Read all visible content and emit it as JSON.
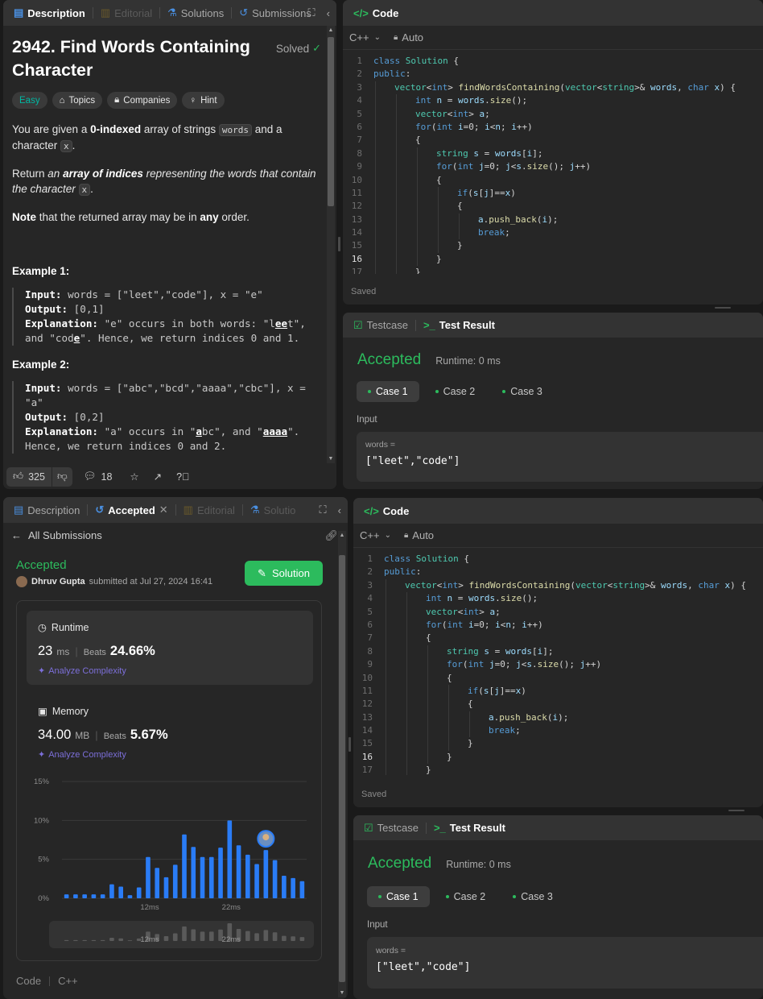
{
  "top_left": {
    "tabs": [
      "Description",
      "Editorial",
      "Solutions",
      "Submissions"
    ],
    "title": "2942. Find Words Containing Character",
    "solved": "Solved",
    "chips": [
      "Easy",
      "Topics",
      "Companies",
      "Hint"
    ],
    "p1_a": "You are given a ",
    "p1_b": "0-indexed",
    "p1_c": " array of strings ",
    "p1_code1": "words",
    "p1_d": " and a character ",
    "p1_code2": "x",
    "p1_e": ".",
    "p2_a": "Return ",
    "p2_b": "an ",
    "p2_c": "array of indices",
    "p2_d": " representing the words that contain the character ",
    "p2_code": "x",
    "p2_e": ".",
    "p3_a": "Note",
    "p3_b": " that the returned array may be in ",
    "p3_c": "any",
    "p3_d": " order.",
    "ex1_title": "Example 1:",
    "ex1_input_label": "Input:",
    "ex1_input": " words = [\"leet\",\"code\"], x = \"e\"",
    "ex1_output_label": "Output:",
    "ex1_output": " [0,1]",
    "ex1_expl_label": "Explanation:",
    "ex1_expl_a": " \"e\" occurs in both words: \"l",
    "ex1_expl_b": "ee",
    "ex1_expl_c": "t\",",
    "ex1_expl_d": "and \"cod",
    "ex1_expl_e": "e",
    "ex1_expl_f": "\". Hence, we return indices 0 and 1.",
    "ex2_title": "Example 2:",
    "ex2_input_label": "Input:",
    "ex2_input": " words = [\"abc\",\"bcd\",\"aaaa\",\"cbc\"], x =",
    "ex2_input2": "\"a\"",
    "ex2_output_label": "Output:",
    "ex2_output": " [0,2]",
    "ex2_expl_label": "Explanation:",
    "ex2_expl_a": " \"a\" occurs in \"",
    "ex2_expl_b": "a",
    "ex2_expl_c": "bc\", and \"",
    "ex2_expl_d": "aaaa",
    "ex2_expl_e": "\".",
    "ex2_expl_f": "Hence, we return indices 0 and 2.",
    "likes": "325",
    "comments": "18"
  },
  "code": {
    "tab_label": "Code",
    "language": "C++",
    "auto": "Auto",
    "saved": "Saved",
    "line_numbers": [
      "1",
      "2",
      "3",
      "4",
      "5",
      "6",
      "7",
      "8",
      "9",
      "10",
      "11",
      "12",
      "13",
      "14",
      "15",
      "16",
      "17"
    ]
  },
  "test": {
    "tab_testcase": "Testcase",
    "tab_result": "Test Result",
    "status": "Accepted",
    "runtime": "Runtime: 0 ms",
    "cases": [
      "Case 1",
      "Case 2",
      "Case 3"
    ],
    "input_label": "Input",
    "var_label": "words =",
    "var_value": "[\"leet\",\"code\"]"
  },
  "bottom_left": {
    "tabs": [
      "Description",
      "Accepted",
      "Editorial",
      "Solutio"
    ],
    "back_label": "All Submissions",
    "status": "Accepted",
    "user": "Dhruv Gupta",
    "submitted": "submitted at Jul 27, 2024 16:41",
    "solution_btn": "Solution",
    "runtime_label": "Runtime",
    "runtime_value": "23",
    "runtime_unit": "ms",
    "beats_label": "Beats",
    "runtime_beats": "24.66%",
    "analyze": "Analyze Complexity",
    "memory_label": "Memory",
    "memory_value": "34.00",
    "memory_unit": "MB",
    "memory_beats": "5.67%",
    "footer_code": "Code",
    "footer_lang": "C++"
  },
  "chart_data": {
    "type": "bar",
    "y_ticks": [
      "15%",
      "10%",
      "5%",
      "0%"
    ],
    "x_ticks": [
      "12ms",
      "22ms"
    ],
    "ylim": [
      0,
      15
    ],
    "values": [
      0.5,
      0.5,
      0.5,
      0.5,
      0.5,
      1.8,
      1.5,
      0.4,
      1.4,
      5.3,
      3.9,
      2.7,
      4.3,
      8.2,
      6.6,
      5.3,
      5.3,
      6.5,
      10.0,
      6.8,
      5.6,
      4.4,
      6.2,
      4.9,
      2.9,
      2.6,
      2.2
    ],
    "highlight_index": 22,
    "colors": {
      "bar": "#2a7cf6",
      "grid": "#3a3a3a"
    }
  },
  "colors": {
    "accent_green": "#2cbb5d",
    "panel": "#262626",
    "tabbar": "#333333"
  }
}
